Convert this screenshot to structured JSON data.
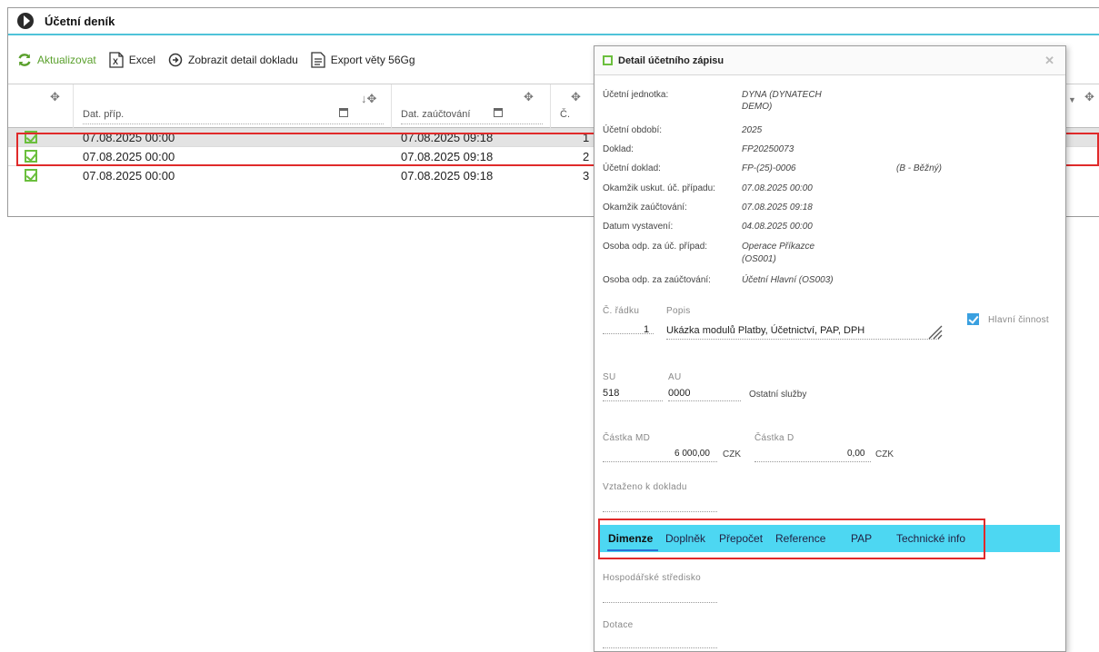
{
  "window": {
    "title": "Účetní deník"
  },
  "toolbar": {
    "refresh_label": "Aktualizovat",
    "excel_label": "Excel",
    "detail_label": "Zobrazit detail dokladu",
    "export_label": "Export věty 56Gg"
  },
  "grid": {
    "columns": [
      "Dat. příp.",
      "Dat. zaúčtování",
      "Č."
    ],
    "rows": [
      {
        "dat_prip": "07.08.2025 00:00",
        "dat_zauct": "07.08.2025 09:18",
        "c": "1"
      },
      {
        "dat_prip": "07.08.2025 00:00",
        "dat_zauct": "07.08.2025 09:18",
        "c": "2"
      },
      {
        "dat_prip": "07.08.2025 00:00",
        "dat_zauct": "07.08.2025 09:18",
        "c": "3"
      }
    ]
  },
  "dialog": {
    "title": "Detail účetního zápisu",
    "fields": [
      {
        "label": "Účetní jednotka:",
        "value": "DYNA (DYNATECH",
        "value2": "DEMO)"
      },
      {
        "label": "Účetní období:",
        "value": "2025"
      },
      {
        "label": "Doklad:",
        "value": "FP20250073"
      },
      {
        "label": "Účetní doklad:",
        "value": "FP-(25)-0006",
        "extra": "(B - Běžný)"
      },
      {
        "label": "Okamžik uskut. úč. případu:",
        "value": "07.08.2025 00:00"
      },
      {
        "label": "Okamžik zaúčtování:",
        "value": "07.08.2025 09:18"
      },
      {
        "label": "Datum vystavení:",
        "value": "04.08.2025 00:00"
      },
      {
        "label": "Osoba odp. za úč. případ:",
        "value": "Operace Příkazce",
        "value2": "(OS001)"
      },
      {
        "label": "Osoba odp. za zaúčtování:",
        "value": "Účetní Hlavní (OS003)"
      }
    ],
    "line": {
      "cislo_label": "Č. řádku",
      "cislo_value": "1",
      "popis_label": "Popis",
      "popis_value": "Ukázka modulů Platby, Účetnictví, PAP, DPH",
      "hlavni_label": "Hlavní činnost",
      "hlavni_checked": true
    },
    "account": {
      "su_label": "SU",
      "su_value": "518",
      "au_label": "AU",
      "au_value": "0000",
      "name": "Ostatní služby"
    },
    "amounts": {
      "md_label": "Částka MD",
      "md_value": "6 000,00",
      "md_currency": "CZK",
      "d_label": "Částka D",
      "d_value": "0,00",
      "d_currency": "CZK"
    },
    "related_label": "Vztaženo k dokladu",
    "tabs": [
      "Dimenze",
      "Doplněk",
      "Přepočet",
      "Reference",
      "PAP",
      "Technické info"
    ],
    "dimensions": {
      "stredisko_label": "Hospodářské středisko",
      "dotace_label": "Dotace"
    }
  },
  "colors": {
    "accent": "#4fc3d9",
    "tabbar": "#4dd7f2",
    "green": "#6bbf3d",
    "highlight": "#e02a2a"
  }
}
